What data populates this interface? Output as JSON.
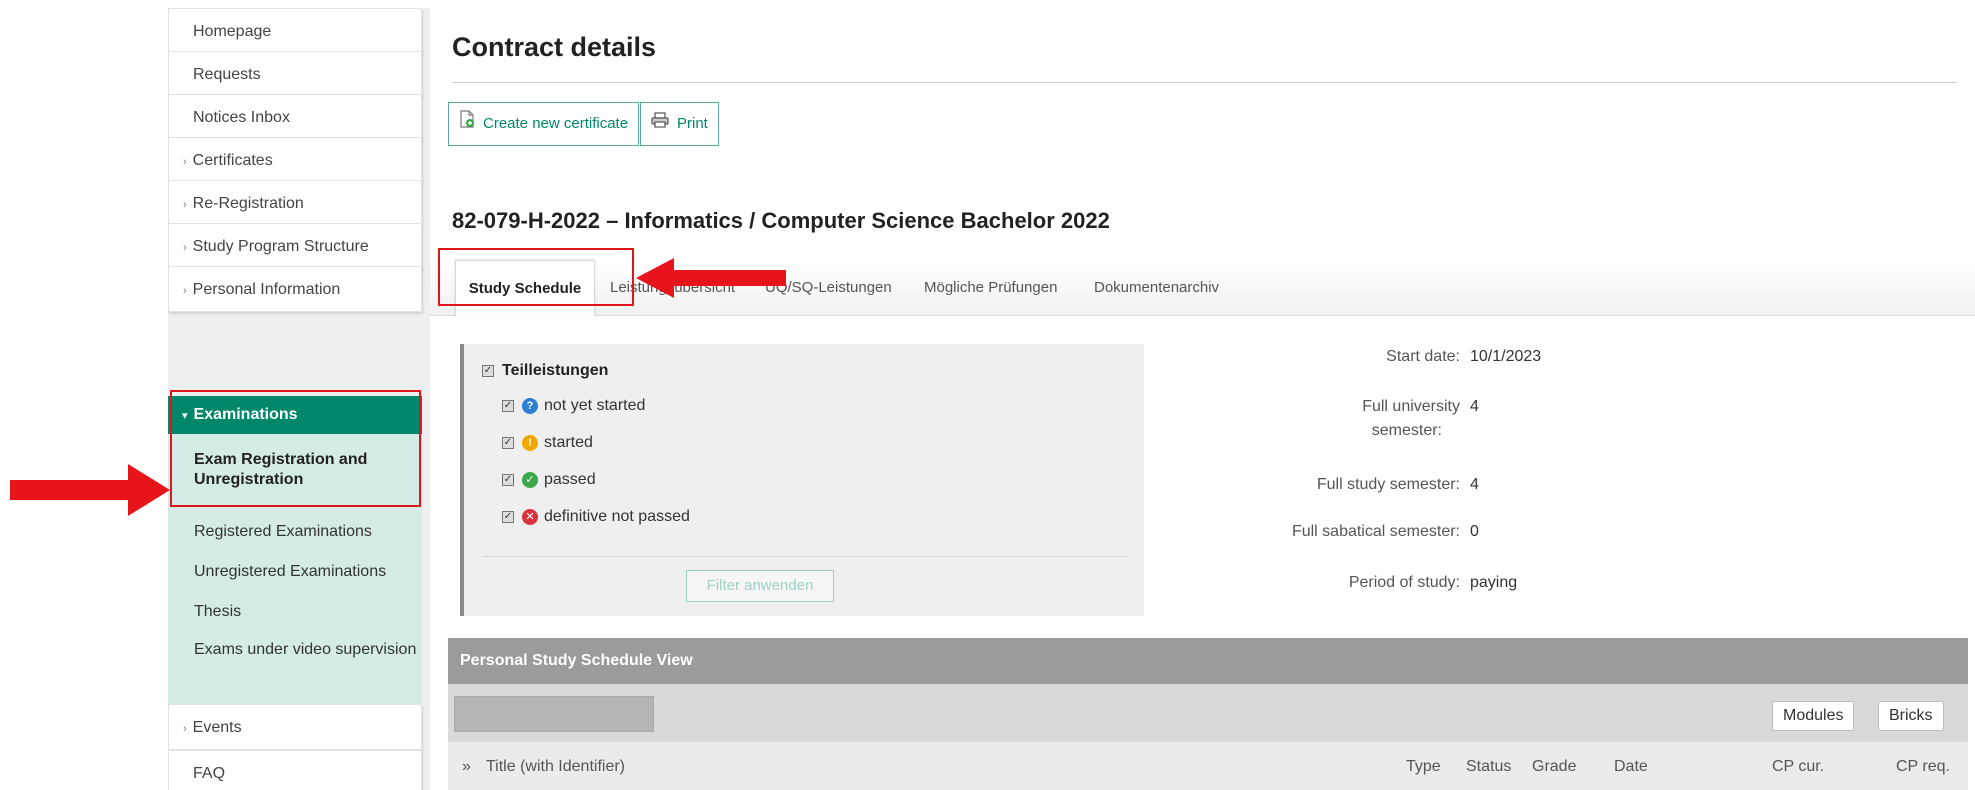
{
  "sidebar": {
    "items": [
      {
        "label": "Homepage",
        "arrow": ""
      },
      {
        "label": "Requests",
        "arrow": ""
      },
      {
        "label": "Notices Inbox",
        "arrow": ""
      },
      {
        "label": "Certificates",
        "arrow": "›"
      },
      {
        "label": "Re-Registration",
        "arrow": "›"
      },
      {
        "label": "Study Program Structure",
        "arrow": "›"
      },
      {
        "label": "Personal Information",
        "arrow": "›"
      }
    ],
    "active": {
      "label": "Examinations",
      "arrow": "▾"
    },
    "submenu": [
      "Exam Registration and Unregistration",
      "Registered Examinations",
      "Unregistered Examinations",
      "Thesis",
      "Exams under video supervision"
    ],
    "bottom_items": [
      {
        "label": "Events",
        "arrow": "›"
      },
      {
        "label": "FAQ",
        "arrow": ""
      }
    ]
  },
  "main": {
    "title": "Contract details",
    "buttons": {
      "create_certificate": "Create new certificate",
      "print": "Print"
    },
    "program_title": "82-079-H-2022 – Informatics / Computer Science Bachelor 2022",
    "tabs": [
      "Study Schedule",
      "Leistungsübersicht",
      "ÜQ/SQ-Leistungen",
      "Mögliche Prüfungen",
      "Dokumentenarchiv"
    ],
    "filter": {
      "group_label": "Teilleistungen",
      "options": [
        {
          "label": "not yet started",
          "icon": "question-icon",
          "symbol": "?",
          "color": "#2b7fd4"
        },
        {
          "label": "started",
          "icon": "exclamation-icon",
          "symbol": "!",
          "color": "#f0a800"
        },
        {
          "label": "passed",
          "icon": "check-icon",
          "symbol": "✓",
          "color": "#3aa84a"
        },
        {
          "label": "definitive not passed",
          "icon": "cross-icon",
          "symbol": "✕",
          "color": "#d9333f"
        }
      ],
      "apply_label": "Filter anwenden"
    },
    "info": {
      "start_date_label": "Start date:",
      "start_date": "10/1/2023",
      "full_univ_label_1": "Full university",
      "full_univ_label_2": "semester:",
      "full_univ": "4",
      "full_study_label": "Full study semester:",
      "full_study": "4",
      "sabbatical_label": "Full sabatical semester:",
      "sabbatical": "0",
      "period_label": "Period of study:",
      "period": "paying"
    },
    "schedule": {
      "header": "Personal Study Schedule View",
      "view_buttons": {
        "modules": "Modules",
        "bricks": "Bricks"
      },
      "columns": {
        "expand": "»",
        "title": "Title (with Identifier)",
        "type": "Type",
        "status": "Status",
        "grade": "Grade",
        "date": "Date",
        "cp_cur": "CP cur.",
        "cp_req": "CP req."
      }
    }
  },
  "colors": {
    "accent": "#00876a",
    "submenu_bg": "#d5ebe5",
    "highlight_red": "#e0141c"
  }
}
